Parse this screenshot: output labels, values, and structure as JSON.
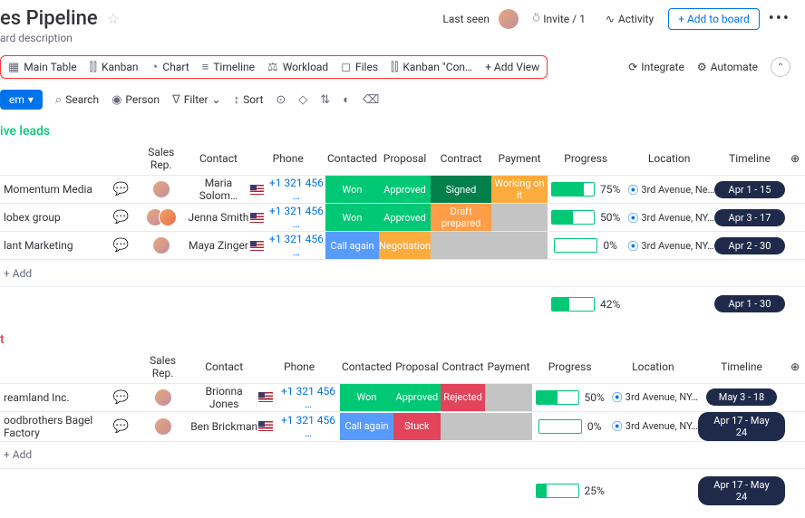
{
  "header": {
    "title": "es Pipeline",
    "desc": "ard description",
    "lastseen": "Last seen",
    "invite": "Invite / 1",
    "activity": "Activity",
    "add_board": "+ Add to board"
  },
  "tabs": {
    "main_table": "Main Table",
    "kanban": "Kanban",
    "chart": "Chart",
    "timeline": "Timeline",
    "workload": "Workload",
    "files": "Files",
    "kanban_con": "Kanban \"Con…",
    "add_view": "+  Add View"
  },
  "right": {
    "integrate": "Integrate",
    "automate": "Automate"
  },
  "toolbar": {
    "new": "em",
    "search": "Search",
    "person": "Person",
    "filter": "Filter",
    "sort": "Sort"
  },
  "columns": {
    "sales_rep": "Sales Rep.",
    "contact": "Contact",
    "phone": "Phone",
    "contacted": "Contacted",
    "proposal": "Proposal",
    "contract": "Contract",
    "payment": "Payment",
    "progress": "Progress",
    "location": "Location",
    "timeline": "Timeline"
  },
  "groups": [
    {
      "title": "ive leads",
      "color": "g-green",
      "rows": [
        {
          "name": "Momentum Media",
          "contact": "Maria Solom…",
          "phone": "+1 321 456 …",
          "contacted": {
            "t": "Won",
            "c": "s-green"
          },
          "proposal": {
            "t": "Approved",
            "c": "s-green"
          },
          "contract": {
            "t": "Signed",
            "c": "s-darkgreen"
          },
          "payment": {
            "t": "Working on it",
            "c": "s-orange"
          },
          "progress": 75,
          "location": "3rd Avenue, Ne…",
          "timeline": "Apr 1 - 15"
        },
        {
          "name": "lobex group",
          "contact": "Jenna Smith",
          "phone": "+1 321 456 …",
          "contacted": {
            "t": "Won",
            "c": "s-green"
          },
          "proposal": {
            "t": "Approved",
            "c": "s-green"
          },
          "contract": {
            "t": "Draft prepared",
            "c": "s-darkorange"
          },
          "payment": null,
          "progress": 50,
          "location": "3rd Avenue, NY…",
          "timeline": "Apr 3 - 17"
        },
        {
          "name": "lant Marketing",
          "contact": "Maya Zinger",
          "phone": "+1 321 456 …",
          "contacted": {
            "t": "Call again",
            "c": "s-blue"
          },
          "proposal": {
            "t": "Negotiation",
            "c": "s-orange"
          },
          "contract": null,
          "payment": null,
          "progress": 0,
          "location": "3rd Avenue, NY…",
          "timeline": "Apr 2 - 30"
        }
      ],
      "add": "+ Add",
      "summary": {
        "progress": 42,
        "timeline": "Apr 1 - 30"
      }
    },
    {
      "title": "t",
      "color": "g-red",
      "rows": [
        {
          "name": "reamland Inc.",
          "contact": "Brionna Jones",
          "phone": "+1 321 456 …",
          "contacted": {
            "t": "Won",
            "c": "s-green"
          },
          "proposal": {
            "t": "Approved",
            "c": "s-green"
          },
          "contract": {
            "t": "Rejected",
            "c": "s-red"
          },
          "payment": null,
          "progress": 50,
          "location": "3rd Avenue, NY…",
          "timeline": "May 3 - 18"
        },
        {
          "name": "oodbrothers Bagel Factory",
          "contact": "Ben Brickman",
          "phone": "+1 321 456 …",
          "contacted": {
            "t": "Call again",
            "c": "s-blue"
          },
          "proposal": {
            "t": "Stuck",
            "c": "s-red"
          },
          "contract": null,
          "payment": null,
          "progress": 0,
          "location": "3rd Avenue, NY…",
          "timeline": "Apr 17 - May 24"
        }
      ],
      "add": "+ Add",
      "summary": {
        "progress": 25,
        "timeline": "Apr 17 - May 24"
      }
    }
  ]
}
